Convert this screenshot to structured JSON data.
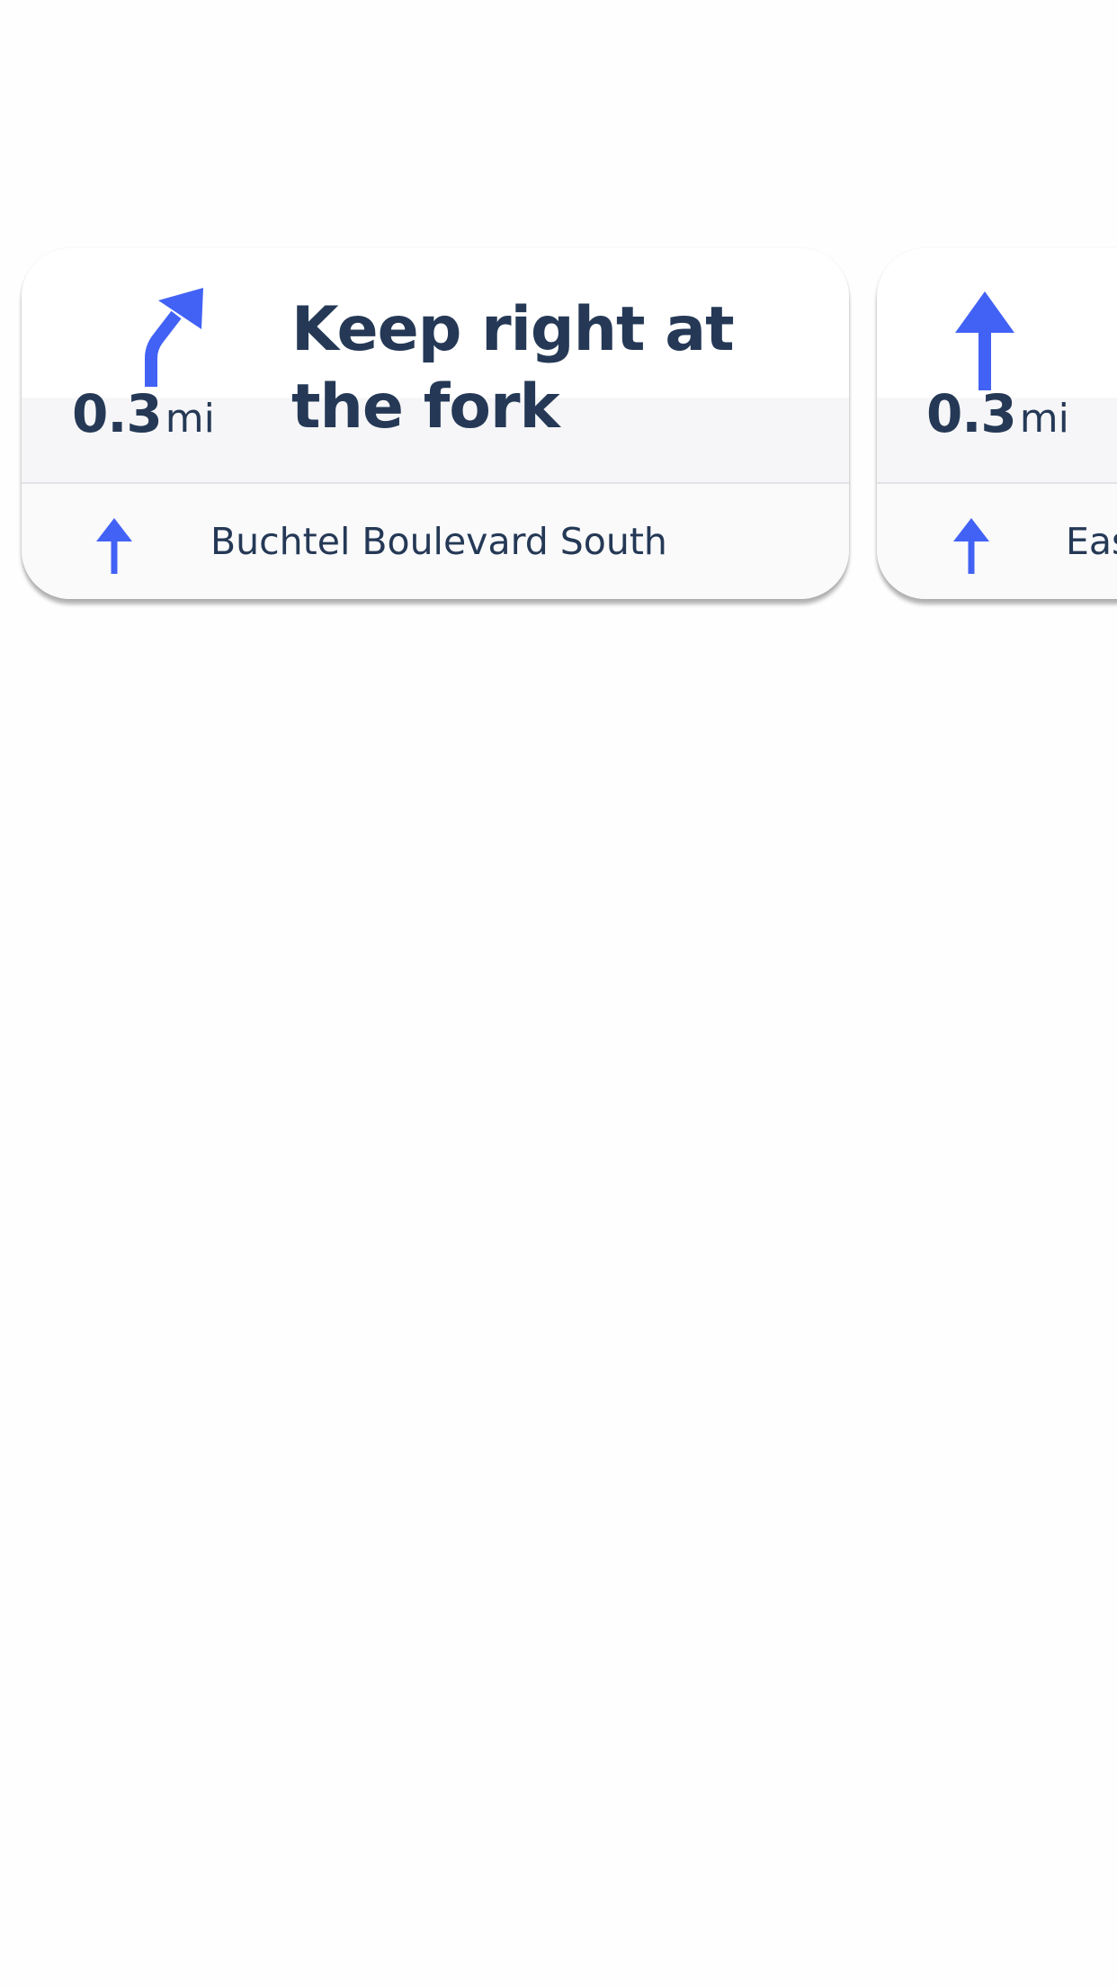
{
  "colors": {
    "accent": "#4262f5",
    "text": "#253956",
    "card_background": "#fafafb"
  },
  "cards": [
    {
      "maneuver_icon": "keep-right-arrow-icon",
      "distance_value": "0.3",
      "distance_unit": "mi",
      "instruction": "Keep right at the fork",
      "next_icon": "straight-arrow-icon",
      "next_street": "Buchtel Boulevard South"
    },
    {
      "maneuver_icon": "straight-arrow-icon",
      "distance_value": "0.3",
      "distance_unit": "mi",
      "instruction": "",
      "next_icon": "straight-arrow-icon",
      "next_street": "Eas"
    }
  ]
}
